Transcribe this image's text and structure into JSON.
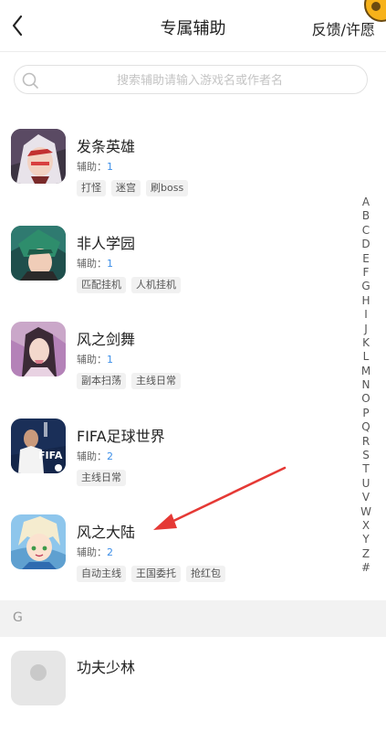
{
  "header": {
    "title": "专属辅助",
    "feedback_label": "反馈/许愿"
  },
  "search": {
    "placeholder": "搜索辅助请输入游戏名或作者名"
  },
  "count_label": "辅助：",
  "games": [
    {
      "name": "发条英雄",
      "count": "1",
      "tags": [
        "打怪",
        "迷宫",
        "刷boss"
      ]
    },
    {
      "name": "非人学园",
      "count": "1",
      "tags": [
        "匹配挂机",
        "人机挂机"
      ]
    },
    {
      "name": "风之剑舞",
      "count": "1",
      "tags": [
        "副本扫荡",
        "主线日常"
      ]
    },
    {
      "name": "FIFA足球世界",
      "count": "2",
      "tags": [
        "主线日常"
      ],
      "icon_text": "FIFA"
    },
    {
      "name": "风之大陆",
      "count": "2",
      "tags": [
        "自动主线",
        "王国委托",
        "抢红包"
      ]
    },
    {
      "name": "功夫少林"
    }
  ],
  "alphabet": [
    "A",
    "B",
    "C",
    "D",
    "E",
    "F",
    "G",
    "H",
    "I",
    "J",
    "K",
    "L",
    "M",
    "N",
    "O",
    "P",
    "Q",
    "R",
    "S",
    "T",
    "U",
    "V",
    "W",
    "X",
    "Y",
    "Z",
    "#"
  ],
  "section_header": "G",
  "colors": {
    "accent_blue": "#3b8ee8",
    "arrow_red": "#e53935",
    "section_bg": "#f2f2f2"
  }
}
